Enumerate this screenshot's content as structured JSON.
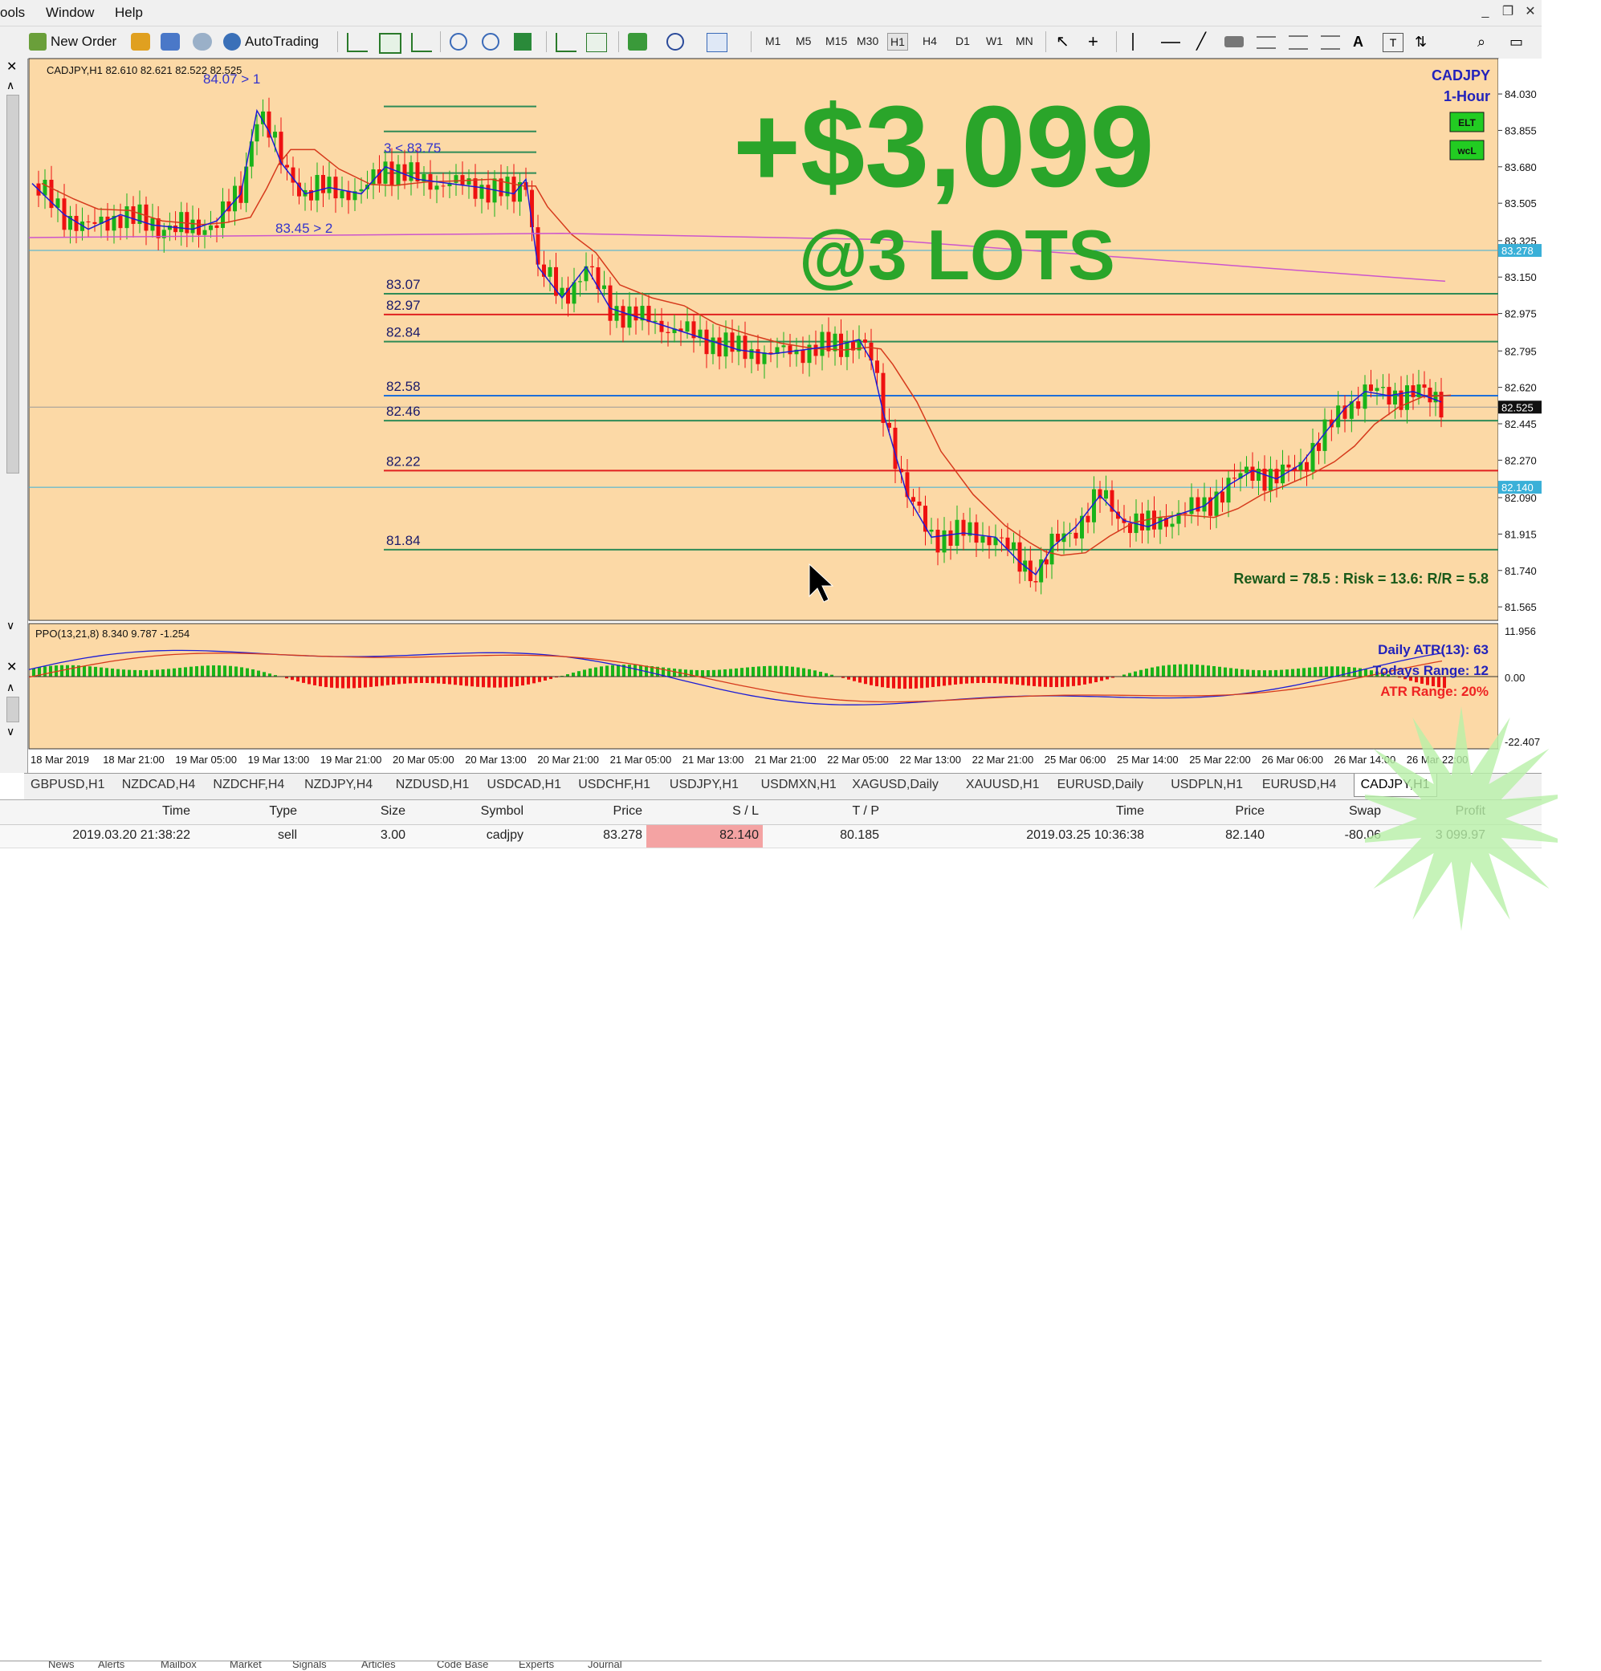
{
  "menu": {
    "items": [
      "ools",
      "Window",
      "Help"
    ]
  },
  "toolbar": {
    "new_order": "New Order",
    "autotrading": "AutoTrading",
    "timeframes": [
      "M1",
      "M5",
      "M15",
      "M30",
      "H1",
      "H4",
      "D1",
      "W1",
      "MN"
    ],
    "active_timeframe": "H1"
  },
  "chart": {
    "header": "CADJPY,H1  82.610 82.621 82.522 82.525",
    "symbol": "CADJPY",
    "period": "1-Hour",
    "badge1": "ELT",
    "badge2": "wcL",
    "overlay_profit": "+$3,099",
    "overlay_lots": "@3 LOTS",
    "annotations": [
      "84.07 > 1",
      "3 < 83.75",
      "83.45 > 2"
    ],
    "level_labels": [
      "83.07",
      "82.97",
      "82.84",
      "82.58",
      "82.46",
      "82.22",
      "81.84"
    ],
    "rr_text": "Reward = 78.5 : Risk = 13.6: R/R = 5.8",
    "price_axis": [
      "84.030",
      "83.855",
      "83.680",
      "83.505",
      "83.325",
      "83.150",
      "82.975",
      "82.795",
      "82.620",
      "82.445",
      "82.270",
      "82.090",
      "81.915",
      "81.740",
      "81.565"
    ],
    "price_tag_278": "83.278",
    "price_tag_525": "82.525",
    "price_tag_140": "82.140",
    "time_axis": [
      "18 Mar 2019",
      "18 Mar 21:00",
      "19 Mar 05:00",
      "19 Mar 13:00",
      "19 Mar 21:00",
      "20 Mar 05:00",
      "20 Mar 13:00",
      "20 Mar 21:00",
      "21 Mar 05:00",
      "21 Mar 13:00",
      "21 Mar 21:00",
      "22 Mar 05:00",
      "22 Mar 13:00",
      "22 Mar 21:00",
      "25 Mar 06:00",
      "25 Mar 14:00",
      "25 Mar 22:00",
      "26 Mar 06:00",
      "26 Mar 14:00",
      "26 Mar 22:00"
    ],
    "colors": {
      "background": "#fcd9a6",
      "bull": "#19b319",
      "bear": "#ee1111",
      "level_green": "#2e8b57",
      "level_red": "#e02020",
      "level_blue": "#1e6fd8",
      "ma_blue": "#1c1cd6",
      "ma_red": "#d63a1c",
      "ma_magenta": "#cc55cc",
      "overlay_green": "#2aa52a"
    }
  },
  "indicator": {
    "header": "PPO(13,21,8) 8.340 9.787 -1.254",
    "atr": "Daily ATR(13): 63",
    "range": "Todays Range: 12",
    "atr_range": "ATR Range: 20%",
    "axis": [
      "11.956",
      "0.00",
      "-22.407"
    ]
  },
  "tabs": [
    "GBPUSD,H1",
    "NZDCAD,H4",
    "NZDCHF,H4",
    "NZDJPY,H4",
    "NZDUSD,H1",
    "USDCAD,H1",
    "USDCHF,H1",
    "USDJPY,H1",
    "USDMXN,H1",
    "XAGUSD,Daily",
    "XAUUSD,H1",
    "EURUSD,Daily",
    "USDPLN,H1",
    "EURUSD,H4",
    "CADJPY,H1"
  ],
  "terminal": {
    "headers": [
      "Time",
      "Type",
      "Size",
      "Symbol",
      "Price",
      "S / L",
      "T / P",
      "Time",
      "Price",
      "Swap",
      "Profit"
    ],
    "row": [
      "2019.03.20 21:38:22",
      "sell",
      "3.00",
      "cadjpy",
      "83.278",
      "82.140",
      "80.185",
      "2019.03.25 10:36:38",
      "82.140",
      "-80.06",
      "3 099.97"
    ],
    "bottom_tabs": [
      "News",
      "Alerts",
      "Mailbox",
      "Market",
      "Signals",
      "Articles",
      "Code Base",
      "Experts",
      "Journal"
    ]
  }
}
